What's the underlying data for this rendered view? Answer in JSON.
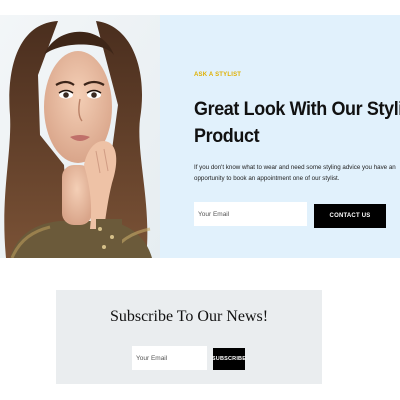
{
  "hero": {
    "eyebrow": "ASK A STYLIST",
    "headline_line1": "Great Look With Our Stylist",
    "headline_line2": "Product",
    "description": "If you don't know what to wear and need some styling advice you have an opportunity to book an appointment one of our stylist.",
    "email_placeholder": "Your Email",
    "email_value": "",
    "contact_label": "CONTACT US",
    "background_color": "#e1f1fc",
    "eyebrow_color": "#e0b000"
  },
  "newsletter": {
    "title": "Subscribe To Our News!",
    "email_placeholder": "Your Email",
    "email_value": "",
    "subscribe_label": "SUBSCRIBE",
    "background_color": "#eaedef"
  }
}
